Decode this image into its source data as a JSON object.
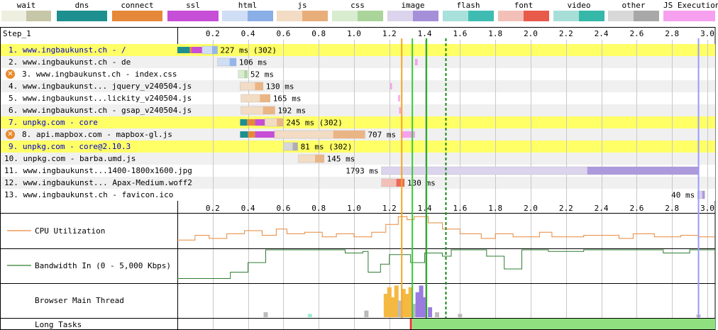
{
  "legend": [
    {
      "label": "wait",
      "light": "#efefe0",
      "dark": "#c6c6a8"
    },
    {
      "label": "dns",
      "light": "#1e8f8f",
      "dark": "#1e8f8f"
    },
    {
      "label": "connect",
      "light": "#e6883a",
      "dark": "#e6883a"
    },
    {
      "label": "ssl",
      "light": "#c74ed6",
      "dark": "#c74ed6"
    },
    {
      "label": "html",
      "light": "#cfdef4",
      "dark": "#8aaee6"
    },
    {
      "label": "js",
      "light": "#f3dcc4",
      "dark": "#e8ae7a"
    },
    {
      "label": "css",
      "light": "#d8ecd0",
      "dark": "#aad59a"
    },
    {
      "label": "image",
      "light": "#dcd3ec",
      "dark": "#a58fd9"
    },
    {
      "label": "flash",
      "light": "#a8e0dc",
      "dark": "#3fbcb2"
    },
    {
      "label": "font",
      "light": "#f3c0b8",
      "dark": "#e85a4a"
    },
    {
      "label": "video",
      "light": "#a8ded8",
      "dark": "#36b8a8"
    },
    {
      "label": "other",
      "light": "#d8d8d8",
      "dark": "#a8a8a8"
    },
    {
      "label": "JS Execution",
      "light": "#f6a0ef",
      "dark": "#f6a0ef"
    }
  ],
  "step_label": "Step_1",
  "ticks": [
    "0.2",
    "0.4",
    "0.6",
    "0.8",
    "1.0",
    "1.2",
    "1.4",
    "1.6",
    "1.8",
    "2.0",
    "2.2",
    "2.4",
    "2.6",
    "2.8",
    "3.0"
  ],
  "time_axis": {
    "max_seconds": 3.0
  },
  "markers": [
    {
      "time": 1.27,
      "color": "#f5a623",
      "style": "solid"
    },
    {
      "time": 1.33,
      "color": "#33cc33",
      "style": "solid"
    },
    {
      "time": 1.41,
      "color": "#22aa22",
      "style": "solid"
    },
    {
      "time": 1.52,
      "color": "#118811",
      "style": "dashed"
    },
    {
      "time": 2.95,
      "color": "#9999ff",
      "style": "solid"
    }
  ],
  "requests": [
    {
      "label": "1. www.ingbaukunst.ch - /",
      "highlight": true,
      "link": true,
      "error": false,
      "start": 0.0,
      "phases": [
        {
          "t": "dns",
          "d": 0.07
        },
        {
          "t": "connect",
          "d": 0.01
        },
        {
          "t": "ssl",
          "d": 0.06
        },
        {
          "t": "html",
          "d": 0.087
        }
      ],
      "duration_text": "227 ms (302)",
      "js": []
    },
    {
      "label": "2. www.ingbaukunst.ch - de",
      "highlight": false,
      "link": false,
      "error": false,
      "start": 0.227,
      "phases": [
        {
          "t": "html",
          "d": 0.106
        }
      ],
      "duration_text": "106 ms",
      "js": [
        [
          1.345,
          1.36
        ]
      ]
    },
    {
      "label": "3. www.ingbaukunst.ch - index.css",
      "highlight": false,
      "link": false,
      "error": true,
      "start": 0.345,
      "phases": [
        {
          "t": "css",
          "d": 0.052
        }
      ],
      "duration_text": "52 ms",
      "js": []
    },
    {
      "label": "4. www.ingbaukunst... jquery_v240504.js",
      "highlight": false,
      "link": false,
      "error": false,
      "start": 0.355,
      "phases": [
        {
          "t": "js",
          "d": 0.13
        }
      ],
      "duration_text": "130 ms",
      "js": [
        [
          1.205,
          1.215
        ]
      ]
    },
    {
      "label": "5. www.ingbaukunst...lickity_v240504.js",
      "highlight": false,
      "link": false,
      "error": false,
      "start": 0.36,
      "phases": [
        {
          "t": "js",
          "d": 0.165
        }
      ],
      "duration_text": "165 ms",
      "js": [
        [
          1.25,
          1.26
        ]
      ]
    },
    {
      "label": "6. www.ingbaukunst.ch - gsap_v240504.js",
      "highlight": false,
      "link": false,
      "error": false,
      "start": 0.36,
      "phases": [
        {
          "t": "js",
          "d": 0.192
        }
      ],
      "duration_text": "192 ms",
      "js": [
        [
          1.255,
          1.265
        ]
      ]
    },
    {
      "label": "7. unpkg.com - core",
      "highlight": true,
      "link": true,
      "error": false,
      "start": 0.355,
      "phases": [
        {
          "t": "dns",
          "d": 0.04
        },
        {
          "t": "connect",
          "d": 0.045
        },
        {
          "t": "ssl",
          "d": 0.055
        },
        {
          "t": "js",
          "d": 0.105
        }
      ],
      "duration_text": "245 ms (302)",
      "js": []
    },
    {
      "label": "8. api.mapbox.com - mapbox-gl.js",
      "highlight": false,
      "link": false,
      "error": true,
      "start": 0.355,
      "phases": [
        {
          "t": "dns",
          "d": 0.045
        },
        {
          "t": "connect",
          "d": 0.04
        },
        {
          "t": "ssl",
          "d": 0.11
        },
        {
          "t": "js",
          "d": 0.512
        }
      ],
      "duration_text": "707 ms",
      "js": [
        [
          1.265,
          1.345
        ]
      ]
    },
    {
      "label": "9. unpkg.com - core@2.10.3",
      "highlight": true,
      "link": true,
      "error": false,
      "start": 0.6,
      "phases": [
        {
          "t": "other",
          "d": 0.081
        }
      ],
      "duration_text": "81 ms (302)",
      "js": []
    },
    {
      "label": "10. unpkg.com - barba.umd.js",
      "highlight": false,
      "link": false,
      "error": false,
      "start": 0.685,
      "phases": [
        {
          "t": "js",
          "d": 0.145
        }
      ],
      "duration_text": "145 ms",
      "js": []
    },
    {
      "label": "11. www.ingbaukunst...1400-1800x1600.jpg",
      "highlight": false,
      "link": false,
      "error": false,
      "start": 1.155,
      "phases": [
        {
          "t": "image",
          "d": 1.793
        }
      ],
      "duration_text": "1793 ms",
      "js": []
    },
    {
      "label": "12. www.ingbaukunst... Apax-Medium.woff2",
      "highlight": false,
      "link": false,
      "error": false,
      "start": 1.155,
      "phases": [
        {
          "t": "font",
          "d": 0.13
        }
      ],
      "duration_text": "130 ms",
      "js": []
    },
    {
      "label": "13. www.ingbaukunst.ch - favicon.ico",
      "highlight": false,
      "link": false,
      "error": false,
      "start": 2.945,
      "phases": [
        {
          "t": "image",
          "d": 0.04
        }
      ],
      "duration_text": "40 ms",
      "js": []
    }
  ],
  "cpu": {
    "label": "CPU Utilization",
    "color": "#e6883a",
    "points": [
      [
        0,
        0.2
      ],
      [
        0.1,
        0.2
      ],
      [
        0.1,
        0.35
      ],
      [
        0.18,
        0.35
      ],
      [
        0.18,
        0.25
      ],
      [
        0.28,
        0.25
      ],
      [
        0.28,
        0.4
      ],
      [
        0.38,
        0.4
      ],
      [
        0.38,
        0.5
      ],
      [
        0.48,
        0.5
      ],
      [
        0.48,
        0.35
      ],
      [
        0.56,
        0.35
      ],
      [
        0.56,
        0.55
      ],
      [
        0.62,
        0.55
      ],
      [
        0.62,
        0.4
      ],
      [
        0.72,
        0.4
      ],
      [
        0.72,
        0.45
      ],
      [
        0.82,
        0.45
      ],
      [
        0.82,
        0.3
      ],
      [
        0.9,
        0.3
      ],
      [
        0.9,
        0.4
      ],
      [
        1.0,
        0.4
      ],
      [
        1.0,
        0.3
      ],
      [
        1.1,
        0.3
      ],
      [
        1.1,
        0.45
      ],
      [
        1.18,
        0.45
      ],
      [
        1.18,
        0.7
      ],
      [
        1.25,
        0.7
      ],
      [
        1.25,
        0.95
      ],
      [
        1.3,
        0.95
      ],
      [
        1.3,
        0.85
      ],
      [
        1.34,
        0.85
      ],
      [
        1.34,
        0.95
      ],
      [
        1.42,
        0.95
      ],
      [
        1.42,
        0.75
      ],
      [
        1.5,
        0.75
      ],
      [
        1.5,
        0.55
      ],
      [
        1.6,
        0.55
      ],
      [
        1.6,
        0.4
      ],
      [
        1.72,
        0.4
      ],
      [
        1.72,
        0.25
      ],
      [
        1.8,
        0.25
      ],
      [
        1.8,
        0.4
      ],
      [
        1.9,
        0.4
      ],
      [
        1.9,
        0.3
      ],
      [
        2.05,
        0.3
      ],
      [
        2.05,
        0.45
      ],
      [
        2.12,
        0.45
      ],
      [
        2.12,
        0.3
      ],
      [
        2.3,
        0.3
      ],
      [
        2.3,
        0.35
      ],
      [
        2.5,
        0.35
      ],
      [
        2.5,
        0.25
      ],
      [
        2.58,
        0.25
      ],
      [
        2.58,
        0.4
      ],
      [
        2.7,
        0.4
      ],
      [
        2.7,
        0.3
      ],
      [
        2.85,
        0.3
      ],
      [
        2.85,
        0.35
      ],
      [
        2.95,
        0.35
      ],
      [
        2.95,
        0.3
      ],
      [
        3.04,
        0.3
      ]
    ]
  },
  "bandwidth": {
    "label": "Bandwidth In (0 - 5,000 Kbps)",
    "color": "#2e7d32",
    "points": [
      [
        0,
        0.1
      ],
      [
        0.3,
        0.1
      ],
      [
        0.3,
        0.3
      ],
      [
        0.4,
        0.3
      ],
      [
        0.4,
        0.6
      ],
      [
        0.5,
        0.6
      ],
      [
        0.5,
        1.0
      ],
      [
        0.95,
        1.0
      ],
      [
        0.95,
        0.9
      ],
      [
        1.05,
        0.9
      ],
      [
        1.05,
        0.95
      ],
      [
        1.08,
        0.95
      ],
      [
        1.08,
        0.3
      ],
      [
        1.15,
        0.3
      ],
      [
        1.15,
        0.55
      ],
      [
        1.2,
        0.55
      ],
      [
        1.2,
        0.85
      ],
      [
        1.32,
        0.85
      ],
      [
        1.32,
        0.6
      ],
      [
        1.4,
        0.6
      ],
      [
        1.4,
        0.9
      ],
      [
        1.5,
        0.9
      ],
      [
        1.5,
        0.8
      ],
      [
        1.55,
        0.8
      ],
      [
        1.55,
        1.0
      ],
      [
        1.75,
        1.0
      ],
      [
        1.75,
        0.8
      ],
      [
        1.85,
        0.8
      ],
      [
        1.85,
        0.4
      ],
      [
        1.95,
        0.4
      ],
      [
        1.95,
        1.0
      ],
      [
        2.1,
        1.0
      ],
      [
        2.1,
        0.95
      ],
      [
        2.3,
        0.95
      ],
      [
        2.3,
        1.0
      ],
      [
        2.75,
        1.0
      ],
      [
        2.75,
        0.9
      ],
      [
        2.9,
        0.9
      ],
      [
        2.9,
        1.0
      ],
      [
        3.04,
        1.0
      ]
    ]
  },
  "main_thread": {
    "label": "Browser Main Thread"
  },
  "long_tasks": {
    "label": "Long Tasks",
    "red_at": 1.32,
    "green_from": 1.33,
    "color": "#90e080",
    "red": "#e53935"
  }
}
